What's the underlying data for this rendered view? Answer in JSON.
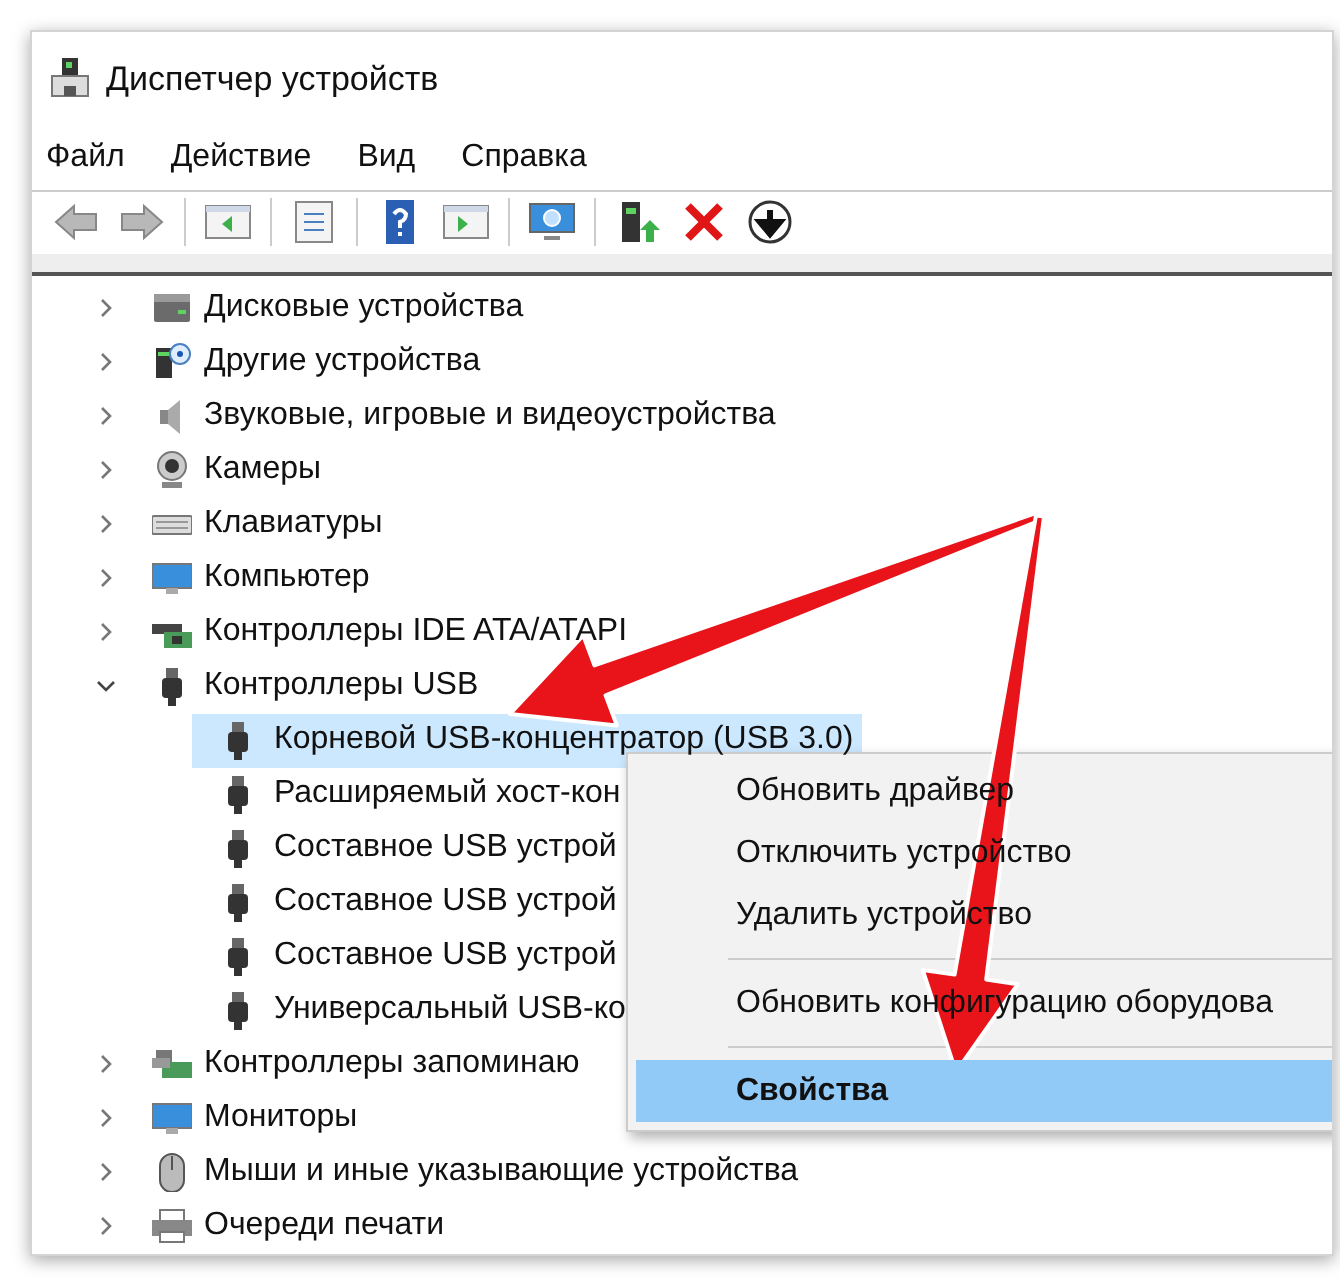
{
  "window": {
    "title": "Диспетчер устройств"
  },
  "menu_bar": [
    "Файл",
    "Действие",
    "Вид",
    "Справка"
  ],
  "toolbar": [
    {
      "kind": "back",
      "disabled": true
    },
    {
      "kind": "forward",
      "disabled": true
    },
    {
      "kind": "separator"
    },
    {
      "kind": "console-tree"
    },
    {
      "kind": "separator"
    },
    {
      "kind": "properties"
    },
    {
      "kind": "separator"
    },
    {
      "kind": "help"
    },
    {
      "kind": "action-pane"
    },
    {
      "kind": "separator"
    },
    {
      "kind": "scan"
    },
    {
      "kind": "separator"
    },
    {
      "kind": "update-driver"
    },
    {
      "kind": "uninstall"
    },
    {
      "kind": "disable"
    }
  ],
  "tree": [
    {
      "label": "Дисковые устройства",
      "kind": "disk",
      "expanded": false
    },
    {
      "label": "Другие устройства",
      "kind": "other",
      "expanded": false
    },
    {
      "label": "Звуковые, игровые и видеоустройства",
      "kind": "sound",
      "expanded": false
    },
    {
      "label": "Камеры",
      "kind": "camera",
      "expanded": false
    },
    {
      "label": "Клавиатуры",
      "kind": "keyboard",
      "expanded": false
    },
    {
      "label": "Компьютер",
      "kind": "computer",
      "expanded": false
    },
    {
      "label": "Контроллеры IDE ATA/ATAPI",
      "kind": "ide",
      "expanded": false
    },
    {
      "label": "Контроллеры USB",
      "kind": "usb",
      "expanded": true,
      "children": [
        {
          "label": "Корневой USB-концентратор (USB 3.0)",
          "kind": "usb",
          "selected": true
        },
        {
          "label": "Расширяемый хост-кон",
          "kind": "usb",
          "selected": false
        },
        {
          "label": "Составное USB устрой",
          "kind": "usb",
          "selected": false
        },
        {
          "label": "Составное USB устрой",
          "kind": "usb",
          "selected": false
        },
        {
          "label": "Составное USB устрой",
          "kind": "usb",
          "selected": false
        },
        {
          "label": "Универсальный USB-ко",
          "kind": "usb",
          "selected": false
        }
      ]
    },
    {
      "label": "Контроллеры запоминаю",
      "kind": "storage",
      "expanded": false
    },
    {
      "label": "Мониторы",
      "kind": "monitor",
      "expanded": false
    },
    {
      "label": "Мыши и иные указывающие устройства",
      "kind": "mouse",
      "expanded": false
    },
    {
      "label": "Очереди печати",
      "kind": "printer",
      "expanded": false
    }
  ],
  "context_menu": [
    {
      "kind": "item",
      "label": "Обновить драйвер",
      "selected": false
    },
    {
      "kind": "item",
      "label": "Отключить устройство",
      "selected": false
    },
    {
      "kind": "item",
      "label": "Удалить устройство",
      "selected": false
    },
    {
      "kind": "separator"
    },
    {
      "kind": "item",
      "label": "Обновить конфигурацию оборудова",
      "selected": false
    },
    {
      "kind": "separator"
    },
    {
      "kind": "item",
      "label": "Свойства",
      "selected": true
    }
  ],
  "annotations": [
    {
      "kind": "arrow"
    },
    {
      "kind": "arrow"
    }
  ]
}
